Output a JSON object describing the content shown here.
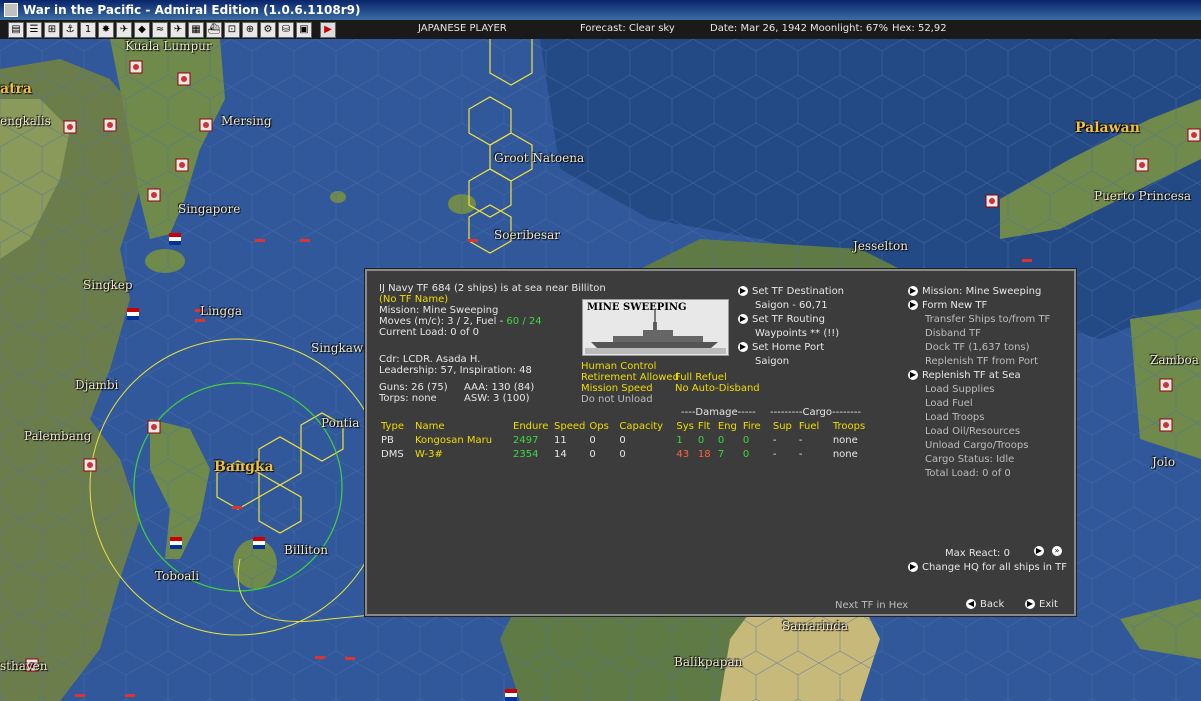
{
  "window": {
    "title": "War in the Pacific - Admiral Edition (1.0.6.1108r9)"
  },
  "toolbar": {
    "player": "JAPANESE PLAYER",
    "forecast": "Forecast: Clear sky",
    "date": "Date: Mar 26, 1942",
    "moonlight": "Moonlight: 67%",
    "hex": "Hex: 52,92",
    "buttons": [
      "report-icon",
      "list-icon",
      "ships-icon",
      "ports-icon",
      "info-icon",
      "flag-icon",
      "air-icon",
      "ground-icon",
      "sub-icon",
      "plane-icon",
      "base-icon",
      "fleet-icon",
      "convoy-icon",
      "task-icon",
      "options-icon",
      "save-icon",
      "camera-icon",
      "turn-icon"
    ]
  },
  "map": {
    "places": [
      {
        "name": "Kuala Lumpur",
        "big": false
      },
      {
        "name": "atra",
        "big": true
      },
      {
        "name": "engkalis",
        "big": false
      },
      {
        "name": "Mersing",
        "big": false
      },
      {
        "name": "Groot Natoena",
        "big": false
      },
      {
        "name": "Singapore",
        "big": false
      },
      {
        "name": "Soeribesar",
        "big": false
      },
      {
        "name": "Jesselton",
        "big": false
      },
      {
        "name": "Palawan",
        "big": true
      },
      {
        "name": "Puerto Princesa",
        "big": false
      },
      {
        "name": "Singkep",
        "big": false
      },
      {
        "name": "Lingga",
        "big": false
      },
      {
        "name": "Singkawa",
        "big": false
      },
      {
        "name": "Djambi",
        "big": false
      },
      {
        "name": "Palembang",
        "big": false
      },
      {
        "name": "Pontia",
        "big": false
      },
      {
        "name": "Bangka",
        "big": true
      },
      {
        "name": "Billiton",
        "big": false
      },
      {
        "name": "Toboali",
        "big": false
      },
      {
        "name": "Samarinda",
        "big": false
      },
      {
        "name": "Balikpapan",
        "big": false
      },
      {
        "name": "sthaven",
        "big": false
      },
      {
        "name": "Zamboa",
        "big": false
      },
      {
        "name": "Jolo",
        "big": false
      }
    ]
  },
  "tf": {
    "header": "IJ Navy TF 684 (2 ships) is at sea near Billiton",
    "name": "(No TF Name)",
    "mission": "Mission: Mine Sweeping",
    "moves": "Moves (m/c): 3 / 2, Fuel - ",
    "fuel": "60 / 24",
    "current_load": "Current Load: 0 of 0",
    "cdr": "Cdr: LCDR. Asada H.",
    "leadership": "Leadership: 57, Inspiration: 48",
    "guns": "Guns: 26 (75)",
    "aaa": "AAA: 130 (84)",
    "torps": "Torps: none",
    "asw": "ASW: 3 (100)",
    "mission_banner": "MINE SWEEPING",
    "human_control": "Human Control",
    "retirement": "Retirement Allowed",
    "full_refuel": "Full Refuel",
    "mission_speed": "Mission Speed",
    "no_auto_disband": "No Auto-Disband",
    "do_not_unload": "Do not Unload",
    "set_dest": "Set TF Destination",
    "dest_value": "Saigon - 60,71",
    "set_routing": "Set TF Routing",
    "waypoints": "Waypoints ** (!!)",
    "set_home": "Set Home Port",
    "home_value": "Saigon"
  },
  "right_menu": {
    "active": [
      "Mission: Mine Sweeping",
      "Form New TF"
    ],
    "items_a": [
      "Transfer Ships to/from TF",
      "Disband TF",
      "Dock TF (1,637 tons)",
      "Replenish TF from Port"
    ],
    "replenish_sea": "Replenish TF at Sea",
    "items_b": [
      "Load Supplies",
      "Load Fuel",
      "Load Troops",
      "Load Oil/Resources",
      "Unload Cargo/Troops",
      "Cargo Status: Idle",
      "Total Load: 0 of 0"
    ],
    "max_react": "Max React: 0",
    "change_hq": "Change HQ for all ships in TF",
    "next_tf": "Next TF in Hex",
    "back": "Back",
    "exit": "Exit"
  },
  "ship_table": {
    "damage_header": "----Damage-----",
    "cargo_header": "---------Cargo--------",
    "columns": [
      "Type",
      "Name",
      "Endure",
      "Speed",
      "Ops",
      "Capacity",
      "Sys",
      "Flt",
      "Eng",
      "Fire",
      "Sup",
      "Fuel",
      "Troops"
    ],
    "rows": [
      {
        "type": "PB",
        "name": "Kongosan Maru",
        "endure": "2497",
        "speed": "11",
        "ops": "0",
        "capacity": "0",
        "sys": "1",
        "flt": "0",
        "eng": "0",
        "fire": "0",
        "sup": "-",
        "fuel": "-",
        "troops": "none"
      },
      {
        "type": "DMS",
        "name": "W-3#",
        "endure": "2354",
        "speed": "14",
        "ops": "0",
        "capacity": "0",
        "sys": "43",
        "flt": "18",
        "eng": "7",
        "fire": "0",
        "sup": "-",
        "fuel": "-",
        "troops": "none"
      }
    ]
  }
}
